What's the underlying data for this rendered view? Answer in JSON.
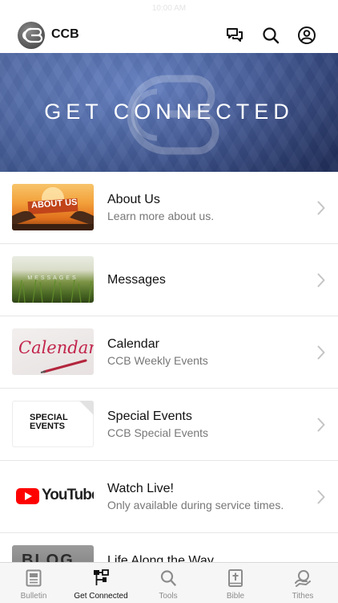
{
  "status_bar": {
    "time": "10:00 AM"
  },
  "header": {
    "app_name": "CCB",
    "logo_text": "CB"
  },
  "banner": {
    "title": "GET CONNECTED"
  },
  "list": {
    "items": [
      {
        "title": "About Us",
        "subtitle": "Learn more about us.",
        "thumb_text": "ABOUT US"
      },
      {
        "title": "Messages",
        "subtitle": "",
        "thumb_text": "MESSAGES"
      },
      {
        "title": "Calendar",
        "subtitle": "CCB Weekly Events",
        "thumb_text": "Calendar"
      },
      {
        "title": "Special Events",
        "subtitle": "CCB Special Events",
        "thumb_text": "SPECIAL EVENTS"
      },
      {
        "title": "Watch Live!",
        "subtitle": "Only available during service times.",
        "thumb_text": "YouTube"
      },
      {
        "title": "Life Along the Way",
        "subtitle": "",
        "thumb_text": "BLOG"
      }
    ]
  },
  "tabbar": {
    "tabs": [
      {
        "label": "Bulletin",
        "icon": "bulletin-icon",
        "active": false
      },
      {
        "label": "Get Connected",
        "icon": "connect-icon",
        "active": true
      },
      {
        "label": "Tools",
        "icon": "search-icon",
        "active": false
      },
      {
        "label": "Bible",
        "icon": "bible-icon",
        "active": false
      },
      {
        "label": "Tithes",
        "icon": "tithes-icon",
        "active": false
      }
    ]
  },
  "colors": {
    "banner": "#4a66b0",
    "active_tab": "#111111",
    "inactive_tab": "#8c8c8c",
    "youtube_red": "#ff0000",
    "calendar_red": "#c2244b"
  }
}
